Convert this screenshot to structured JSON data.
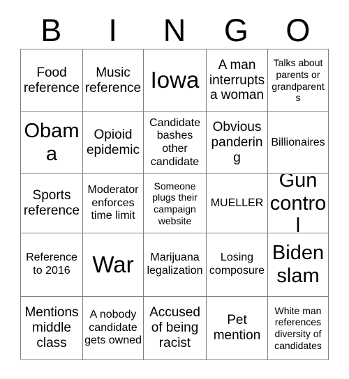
{
  "card": {
    "title": "BINGO",
    "header_letters": [
      "B",
      "I",
      "N",
      "G",
      "O"
    ],
    "grid_size": "5x5",
    "border_color": "#808080",
    "text_color": "#000000",
    "background_color": "#ffffff",
    "rows": [
      [
        {
          "text": "Food reference",
          "size": "md"
        },
        {
          "text": "Music reference",
          "size": "md"
        },
        {
          "text": "Iowa",
          "size": "xl"
        },
        {
          "text": "A man interrupts a woman",
          "size": "md"
        },
        {
          "text": "Talks about parents or grandparents",
          "size": "xs"
        }
      ],
      [
        {
          "text": "Obama",
          "size": "lg"
        },
        {
          "text": "Opioid epidemic",
          "size": "md"
        },
        {
          "text": "Candidate bashes other candidate",
          "size": "sm"
        },
        {
          "text": "Obvious pandering",
          "size": "md"
        },
        {
          "text": "Billionaires",
          "size": "sm"
        }
      ],
      [
        {
          "text": "Sports reference",
          "size": "md"
        },
        {
          "text": "Moderator enforces time limit",
          "size": "sm"
        },
        {
          "text": "Someone plugs their campaign website",
          "size": "xs"
        },
        {
          "text": "MUELLER",
          "size": "sm"
        },
        {
          "text": "Gun control",
          "size": "lg"
        }
      ],
      [
        {
          "text": "Reference to 2016",
          "size": "sm"
        },
        {
          "text": "War",
          "size": "xl"
        },
        {
          "text": "Marijuana legalization",
          "size": "sm"
        },
        {
          "text": "Losing composure",
          "size": "sm"
        },
        {
          "text": "Biden slam",
          "size": "lg"
        }
      ],
      [
        {
          "text": "Mentions middle class",
          "size": "md"
        },
        {
          "text": "A nobody candidate gets owned",
          "size": "sm"
        },
        {
          "text": "Accused of being racist",
          "size": "md"
        },
        {
          "text": "Pet mention",
          "size": "md"
        },
        {
          "text": "White man references diversity of candidates",
          "size": "xs"
        }
      ]
    ]
  }
}
